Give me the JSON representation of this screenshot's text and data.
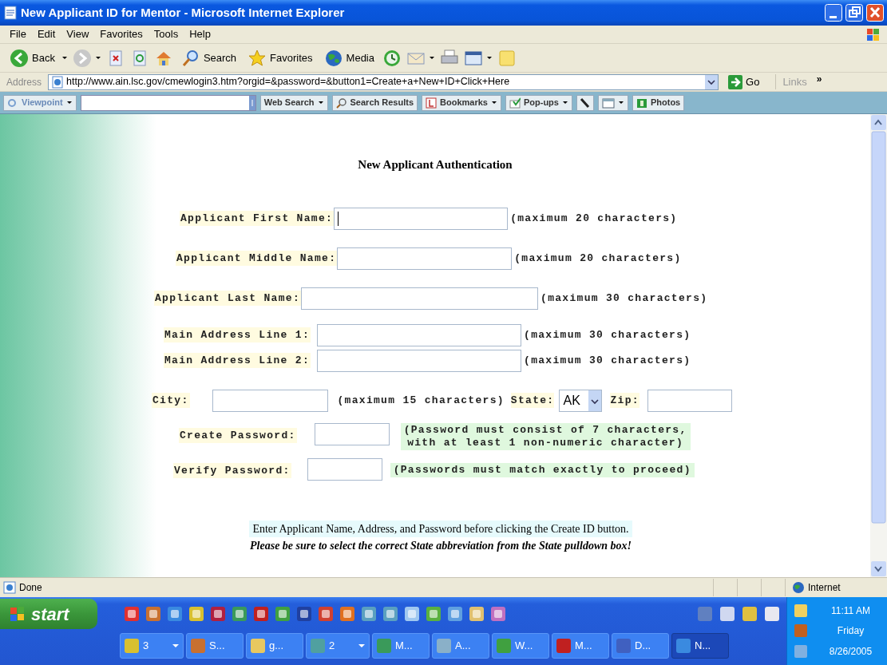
{
  "window": {
    "title": "New Applicant ID for Mentor - Microsoft Internet Explorer"
  },
  "menu": [
    "File",
    "Edit",
    "View",
    "Favorites",
    "Tools",
    "Help"
  ],
  "toolbar": [
    {
      "kind": "back",
      "label": "Back",
      "dropdown": true
    },
    {
      "kind": "forward",
      "dropdown": true
    },
    {
      "kind": "stop"
    },
    {
      "kind": "refresh"
    },
    {
      "kind": "home"
    },
    {
      "kind": "search",
      "label": "Search"
    },
    {
      "kind": "favorites",
      "label": "Favorites"
    },
    {
      "kind": "media",
      "label": "Media"
    },
    {
      "kind": "history"
    },
    {
      "kind": "mail",
      "dropdown": true
    },
    {
      "kind": "print"
    },
    {
      "kind": "edit",
      "dropdown": true
    },
    {
      "kind": "note"
    }
  ],
  "address_bar": {
    "label": "Address",
    "url": "http://www.ain.lsc.gov/cmewlogin3.htm?orgid=&password=&button1=Create+a+New+ID+Click+Here",
    "go": "Go",
    "links": "Links",
    "more": "»"
  },
  "viewpoint_bar": [
    {
      "kind": "viewpoint",
      "label": "Viewpoint",
      "dropdown": true
    },
    {
      "kind": "search_box"
    },
    {
      "kind": "web_search",
      "label": "Web Search",
      "dropdown": true
    },
    {
      "kind": "search_results",
      "label": "Search Results"
    },
    {
      "kind": "bookmarks",
      "label": "Bookmarks",
      "dropdown": true
    },
    {
      "kind": "popups",
      "label": "Pop-ups",
      "dropdown": true
    },
    {
      "kind": "pencil"
    },
    {
      "kind": "window",
      "dropdown": true
    },
    {
      "kind": "photos",
      "label": "Photos"
    }
  ],
  "page": {
    "heading": "New Applicant Authentication",
    "rows": [
      {
        "kind": "text",
        "label": "Applicant First Name:",
        "note": "(maximum 20 characters)",
        "focused": true
      },
      {
        "kind": "text",
        "label": "Applicant Middle Name:",
        "note": "(maximum 20 characters)",
        "focused": false
      },
      {
        "kind": "text",
        "label": "Applicant Last Name:",
        "note": "(maximum 30 characters)",
        "focused": false
      },
      {
        "kind": "text",
        "label": "Main Address Line 1:",
        "note": "(maximum 30 characters)",
        "focused": false
      },
      {
        "kind": "text",
        "label": "Main Address Line 2:",
        "note": "(maximum 30 characters)",
        "focused": false
      },
      {
        "kind": "city",
        "label": "City:",
        "note": "(maximum 15 characters)",
        "state_label": "State:",
        "state_value": "AK",
        "zip_label": "Zip:"
      },
      {
        "kind": "password",
        "label": "Create Password:",
        "note_lines": [
          "(Password must consist of 7 characters,",
          "with at least 1 non-numeric character)"
        ]
      },
      {
        "kind": "password",
        "label": "Verify Password:",
        "note_lines": [
          "(Passwords must match exactly to proceed)"
        ]
      }
    ],
    "instruction": "Enter Applicant Name, Address, and Password before clicking the Create ID button.",
    "warning": "Please be sure to select the correct State abbreviation from the State pulldown box!"
  },
  "status_bar": {
    "status": "Done",
    "zone": "Internet"
  },
  "taskbar": {
    "start": "start",
    "buttons": [
      {
        "kind": "clock",
        "label": "3",
        "group": true,
        "active": false
      },
      {
        "kind": "tool",
        "label": "S...",
        "group": false,
        "active": false
      },
      {
        "kind": "folder",
        "label": "g...",
        "group": false,
        "active": false
      },
      {
        "kind": "net",
        "label": "2",
        "group": true,
        "active": false
      },
      {
        "kind": "excel",
        "label": "M...",
        "group": false,
        "active": false
      },
      {
        "kind": "globe",
        "label": "A...",
        "group": false,
        "active": false
      },
      {
        "kind": "tree",
        "label": "W...",
        "group": false,
        "active": false
      },
      {
        "kind": "bird",
        "label": "M...",
        "group": false,
        "active": false
      },
      {
        "kind": "doc",
        "label": "D...",
        "group": false,
        "active": false
      },
      {
        "kind": "ie",
        "label": "N...",
        "group": false,
        "active": true
      }
    ],
    "time": "11:11 AM",
    "day": "Friday",
    "date": "8/26/2005"
  }
}
